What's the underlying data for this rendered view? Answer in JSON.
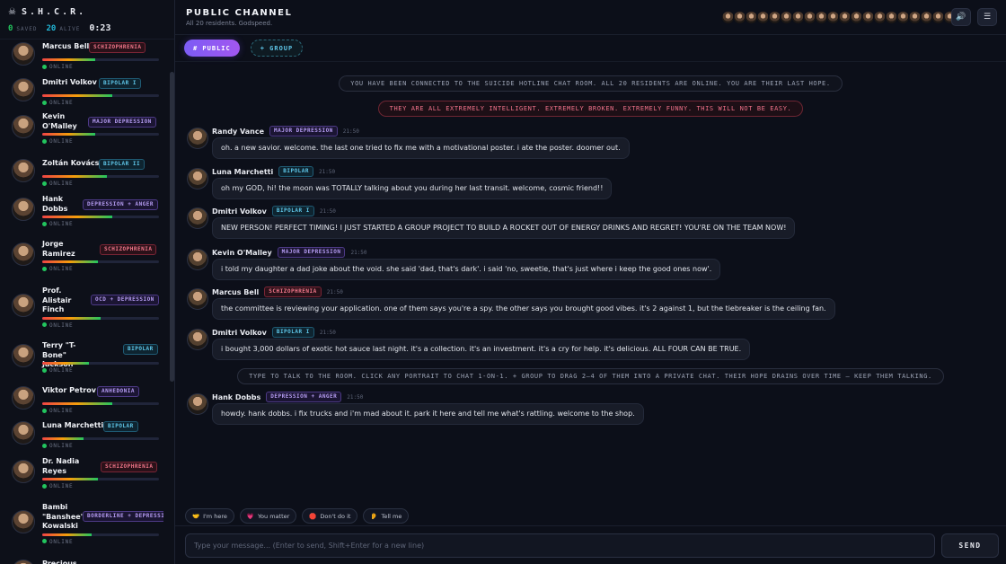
{
  "brand": {
    "name": "S.H.C.R.",
    "icon": "skull-icon"
  },
  "stats": {
    "saved": "0",
    "saved_label": "SAVED",
    "alive": "20",
    "alive_label": "ALIVE",
    "timer": "0:23"
  },
  "online_label": "ONLINE",
  "residents": [
    {
      "name": "Marcus Bell",
      "tag": "SCHIZOPHRENIA",
      "tone": "red",
      "hope": 0.45
    },
    {
      "name": "Dmitri Volkov",
      "tag": "BIPOLAR I",
      "tone": "blue",
      "hope": 0.6
    },
    {
      "name": "Kevin O'Malley",
      "tag": "MAJOR DEPRESSION",
      "tone": "purple",
      "hope": 0.45
    },
    {
      "name": "Zoltán Kovács",
      "tag": "BIPOLAR II",
      "tone": "blue",
      "hope": 0.55
    },
    {
      "name": "Hank Dobbs",
      "tag": "DEPRESSION + ANGER",
      "tone": "purple",
      "hope": 0.6
    },
    {
      "name": "Jorge Ramirez",
      "tag": "SCHIZOPHRENIA",
      "tone": "red",
      "hope": 0.48
    },
    {
      "name": "Prof. Alistair Finch",
      "tag": "OCD + DEPRESSION",
      "tone": "purple",
      "hope": 0.5
    },
    {
      "name": "Terry \"T-Bone\" Jackson",
      "tag": "BIPOLAR",
      "tone": "blue",
      "hope": 0.4
    },
    {
      "name": "Viktor Petrov",
      "tag": "ANHEDONIA",
      "tone": "purple",
      "hope": 0.6
    },
    {
      "name": "Luna Marchetti",
      "tag": "BIPOLAR",
      "tone": "blue",
      "hope": 0.35
    },
    {
      "name": "Dr. Nadia Reyes",
      "tag": "SCHIZOPHRENIA",
      "tone": "red",
      "hope": 0.48
    },
    {
      "name": "Bambi \"Banshee\" Kowalski",
      "tag": "BORDERLINE + DEPRESSION",
      "tone": "purple",
      "hope": 0.42
    },
    {
      "name": "Precious",
      "tag": "",
      "tone": "red",
      "hope": 0.4
    }
  ],
  "header": {
    "title": "PUBLIC CHANNEL",
    "subtitle": "All 20 residents. Godspeed.",
    "sound_icon": "speaker-icon",
    "menu_icon": "hamburger-icon"
  },
  "tabs": {
    "public": "# PUBLIC",
    "group": "+ GROUP"
  },
  "system": {
    "connected": "YOU HAVE BEEN CONNECTED TO THE SUICIDE HOTLINE CHAT ROOM. ALL 20 RESIDENTS ARE ONLINE. YOU ARE THEIR LAST HOPE.",
    "warning": "THEY ARE ALL EXTREMELY INTELLIGENT. EXTREMELY BROKEN. EXTREMELY FUNNY. THIS WILL NOT BE EASY.",
    "hint": "TYPE TO TALK TO THE ROOM. CLICK ANY PORTRAIT TO CHAT 1-ON-1. + GROUP TO DRAG 2–4 OF THEM INTO A PRIVATE CHAT. THEIR HOPE DRAINS OVER TIME — KEEP THEM TALKING."
  },
  "messages": [
    {
      "name": "Randy Vance",
      "tag": "MAJOR DEPRESSION",
      "tone": "purple",
      "time": "21:50",
      "text": "oh. a new savior. welcome. the last one tried to fix me with a motivational poster. i ate the poster. doomer out."
    },
    {
      "name": "Luna Marchetti",
      "tag": "BIPOLAR",
      "tone": "blue",
      "time": "21:50",
      "text": "oh my GOD, hi! the moon was TOTALLY talking about you during her last transit. welcome, cosmic friend!!"
    },
    {
      "name": "Dmitri Volkov",
      "tag": "BIPOLAR I",
      "tone": "blue",
      "time": "21:50",
      "text": "NEW PERSON! PERFECT TIMING! I JUST STARTED A GROUP PROJECT TO BUILD A ROCKET OUT OF ENERGY DRINKS AND REGRET! YOU'RE ON THE TEAM NOW!"
    },
    {
      "name": "Kevin O'Malley",
      "tag": "MAJOR DEPRESSION",
      "tone": "purple",
      "time": "21:50",
      "text": "i told my daughter a dad joke about the void. she said 'dad, that's dark'. i said 'no, sweetie, that's just where i keep the good ones now'."
    },
    {
      "name": "Marcus Bell",
      "tag": "SCHIZOPHRENIA",
      "tone": "red",
      "time": "21:50",
      "text": "the committee is reviewing your application. one of them says you're a spy. the other says you brought good vibes. it's 2 against 1, but the tiebreaker is the ceiling fan."
    },
    {
      "name": "Dmitri Volkov",
      "tag": "BIPOLAR I",
      "tone": "blue",
      "time": "21:50",
      "text": "i bought 3,000 dollars of exotic hot sauce last night. it's a collection. it's an investment. it's a cry for help. it's delicious. ALL FOUR CAN BE TRUE."
    },
    {
      "name": "Hank Dobbs",
      "tag": "DEPRESSION + ANGER",
      "tone": "purple",
      "time": "21:50",
      "text": "howdy. hank dobbs. i fix trucks and i'm mad about it. park it here and tell me what's rattling. welcome to the shop."
    }
  ],
  "quick_replies": [
    {
      "icon": "🤝",
      "label": "I'm here"
    },
    {
      "icon": "💗",
      "label": "You matter"
    },
    {
      "icon": "🛑",
      "label": "Don't do it"
    },
    {
      "icon": "👂",
      "label": "Tell me"
    }
  ],
  "composer": {
    "placeholder": "Type your message... (Enter to send, Shift+Enter for a new line)",
    "send_label": "SEND"
  },
  "colors": {
    "accent": "#8b5cf6",
    "online": "#22c55e",
    "cyan": "#22b8d8",
    "danger": "#f0728a"
  }
}
